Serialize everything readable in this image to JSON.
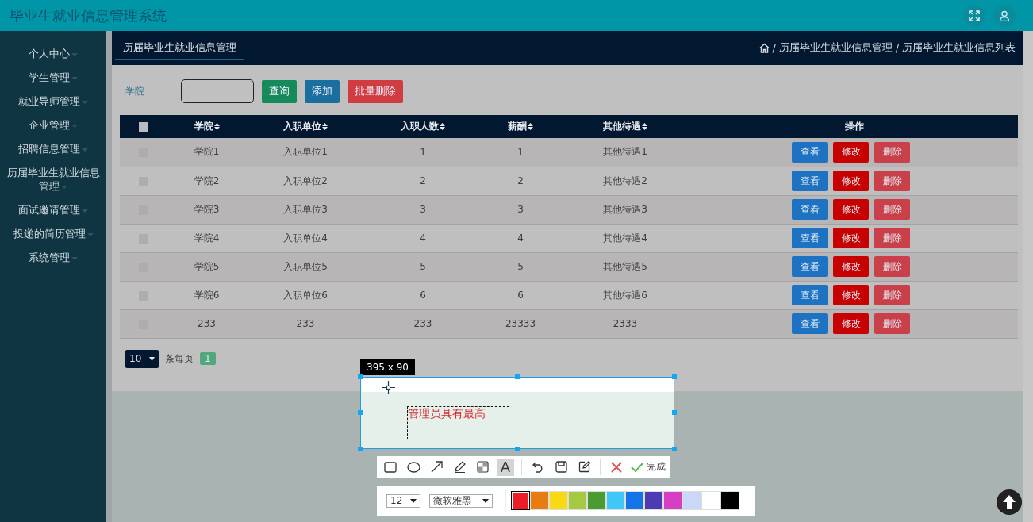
{
  "header": {
    "title": "毕业生就业信息管理系统"
  },
  "sidebar": {
    "items": [
      {
        "label": "个人中心",
        "has_menu": true
      },
      {
        "label": "学生管理",
        "has_menu": true
      },
      {
        "label": "就业导师管理",
        "has_menu": true
      },
      {
        "label": "企业管理",
        "has_menu": true
      },
      {
        "label": "招聘信息管理",
        "has_menu": true
      },
      {
        "label": "历届毕业生就业信息管理",
        "has_menu": true
      },
      {
        "label": "面试邀请管理",
        "has_menu": true
      },
      {
        "label": "投递的简历管理",
        "has_menu": true
      },
      {
        "label": "系统管理",
        "has_menu": true
      }
    ]
  },
  "page_tab": "历届毕业生就业信息管理",
  "breadcrumb": {
    "separator": "/",
    "items": [
      "历届毕业生就业信息管理",
      "历届毕业生就业信息列表"
    ]
  },
  "search": {
    "label": "学院",
    "buttons": [
      {
        "label": "查询",
        "kind": "query"
      },
      {
        "label": "添加",
        "kind": "add"
      },
      {
        "label": "批量删除",
        "kind": "batch-delete"
      }
    ]
  },
  "table": {
    "all_checked": false,
    "columns": [
      "学院",
      "入职单位",
      "入职人数",
      "薪酬",
      "其他待遇",
      "操作"
    ],
    "rows": [
      {
        "checked": false,
        "cells": [
          "学院1",
          "入职单位1",
          "1",
          "1",
          "其他待遇1"
        ],
        "actions": [
          {
            "label": "查看",
            "kind": "view"
          },
          {
            "label": "修改",
            "kind": "edit"
          },
          {
            "label": "删除",
            "kind": "delete"
          }
        ]
      },
      {
        "checked": false,
        "cells": [
          "学院2",
          "入职单位2",
          "2",
          "2",
          "其他待遇2"
        ],
        "actions": [
          {
            "label": "查看",
            "kind": "view"
          },
          {
            "label": "修改",
            "kind": "edit"
          },
          {
            "label": "删除",
            "kind": "delete"
          }
        ]
      },
      {
        "checked": false,
        "cells": [
          "学院3",
          "入职单位3",
          "3",
          "3",
          "其他待遇3"
        ],
        "actions": [
          {
            "label": "查看",
            "kind": "view"
          },
          {
            "label": "修改",
            "kind": "edit"
          },
          {
            "label": "删除",
            "kind": "delete"
          }
        ]
      },
      {
        "checked": false,
        "cells": [
          "学院4",
          "入职单位4",
          "4",
          "4",
          "其他待遇4"
        ],
        "actions": [
          {
            "label": "查看",
            "kind": "view"
          },
          {
            "label": "修改",
            "kind": "edit"
          },
          {
            "label": "删除",
            "kind": "delete"
          }
        ]
      },
      {
        "checked": false,
        "cells": [
          "学院5",
          "入职单位5",
          "5",
          "5",
          "其他待遇5"
        ],
        "actions": [
          {
            "label": "查看",
            "kind": "view"
          },
          {
            "label": "修改",
            "kind": "edit"
          },
          {
            "label": "删除",
            "kind": "delete"
          }
        ]
      },
      {
        "checked": false,
        "cells": [
          "学院6",
          "入职单位6",
          "6",
          "6",
          "其他待遇6"
        ],
        "actions": [
          {
            "label": "查看",
            "kind": "view"
          },
          {
            "label": "修改",
            "kind": "edit"
          },
          {
            "label": "删除",
            "kind": "delete"
          }
        ]
      },
      {
        "checked": false,
        "cells": [
          "233",
          "233",
          "233",
          "23333",
          "2333"
        ],
        "actions": [
          {
            "label": "查看",
            "kind": "view"
          },
          {
            "label": "修改",
            "kind": "edit"
          },
          {
            "label": "删除",
            "kind": "delete"
          }
        ]
      }
    ]
  },
  "pagination": {
    "page_size": "10",
    "per_page_label": "条每页",
    "pages": [
      {
        "label": "1",
        "selected": true
      }
    ]
  },
  "capture": {
    "size_label": "395 x 90",
    "annotation": "管理员具有最高",
    "tools": [
      {
        "kind": "rect",
        "selected": false
      },
      {
        "kind": "ellipse",
        "selected": false
      },
      {
        "kind": "arrow",
        "selected": false
      },
      {
        "kind": "pen",
        "selected": false
      },
      {
        "kind": "mosaic",
        "selected": false
      },
      {
        "kind": "text",
        "label": "A",
        "selected": true
      },
      {
        "kind": "undo",
        "selected": false
      },
      {
        "kind": "save",
        "selected": false
      },
      {
        "kind": "edit",
        "selected": false
      },
      {
        "kind": "cancel",
        "selected": false
      },
      {
        "kind": "done",
        "label": "完成",
        "selected": false
      }
    ],
    "font_size": "12",
    "font_name": "微软雅黑",
    "colors": [
      {
        "color": "#ee1c24",
        "selected": true
      },
      {
        "color": "#e87c11",
        "selected": false
      },
      {
        "color": "#f7d915",
        "selected": false
      },
      {
        "color": "#a5c940",
        "selected": false
      },
      {
        "color": "#4b9c30",
        "selected": false
      },
      {
        "color": "#3fc8f7",
        "selected": false
      },
      {
        "color": "#1473e6",
        "selected": false
      },
      {
        "color": "#4c3bb2",
        "selected": false
      },
      {
        "color": "#d63fc4",
        "selected": false
      },
      {
        "color": "#c9d8f7",
        "selected": false
      },
      {
        "color": "#ffffff",
        "selected": false
      },
      {
        "color": "#000000",
        "selected": false
      }
    ]
  }
}
